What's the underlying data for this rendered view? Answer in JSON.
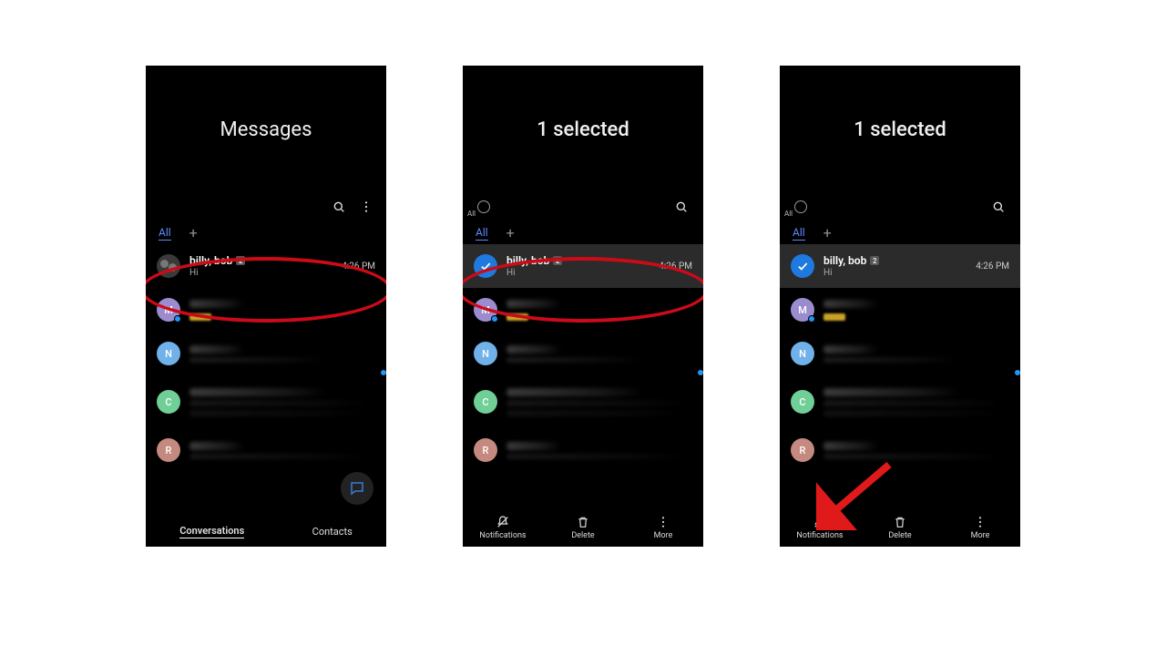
{
  "panel1": {
    "title": "Messages",
    "tab_all": "All",
    "convo": {
      "name": "billy, bob",
      "badge": "2",
      "preview": "Hi",
      "time": "4:26 PM"
    },
    "blurred_initials": [
      "M",
      "N",
      "C",
      "R"
    ],
    "bottom": {
      "conversations": "Conversations",
      "contacts": "Contacts"
    }
  },
  "panel2": {
    "title": "1 selected",
    "all_label": "All",
    "tab_all": "All",
    "convo": {
      "name": "billy, bob",
      "badge": "2",
      "preview": "Hi",
      "time": "4:26 PM"
    },
    "blurred_initials": [
      "M",
      "N",
      "C",
      "R"
    ],
    "actions": {
      "notifications": "Notifications",
      "delete": "Delete",
      "more": "More"
    }
  },
  "panel3": {
    "title": "1 selected",
    "all_label": "All",
    "tab_all": "All",
    "convo": {
      "name": "billy, bob",
      "badge": "2",
      "preview": "Hi",
      "time": "4:26 PM"
    },
    "blurred_initials": [
      "M",
      "N",
      "C",
      "R"
    ],
    "actions": {
      "notifications": "Notifications",
      "delete": "Delete",
      "more": "More"
    }
  }
}
